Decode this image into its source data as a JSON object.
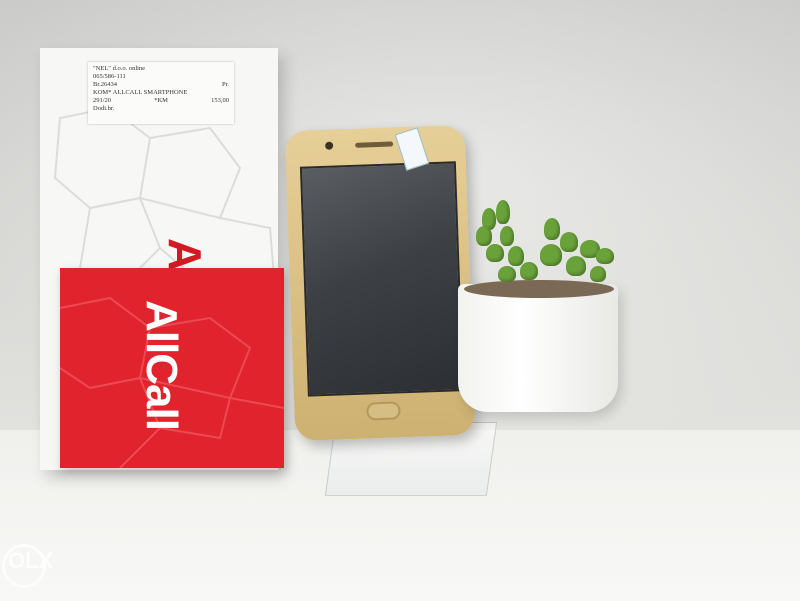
{
  "scene": {
    "description_colors": {
      "box_red": "#e0232c",
      "phone_gold": "#d8bd80",
      "plant_green": "#6aa23a"
    }
  },
  "price_label": {
    "line1": "\"NEL\" d.o.o. online",
    "line2": "065/586-111",
    "line3": "Br.26434",
    "line3_right": "Pr.",
    "line4": "KOM* ALLCALL SMARTPHONE",
    "line5_left": "291/20",
    "line5_mid": "*KM",
    "line5_right": "153,00",
    "line6": "Dodi.br."
  },
  "box": {
    "brand": "AllCall",
    "card_brand": "AllCall"
  },
  "watermark": {
    "text": "OLX"
  }
}
